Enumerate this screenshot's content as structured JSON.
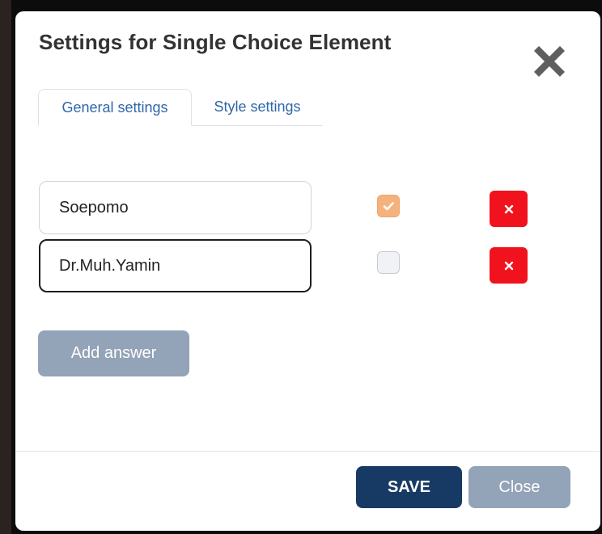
{
  "modal": {
    "title": "Settings for Single Choice Element",
    "close_icon": "close-x-icon"
  },
  "tabs": [
    {
      "label": "General settings",
      "active": true
    },
    {
      "label": "Style settings",
      "active": false
    }
  ],
  "answers": [
    {
      "value": "Soepomo",
      "correct": true,
      "focused": false
    },
    {
      "value": "Dr.Muh.Yamin",
      "correct": false,
      "focused": true
    }
  ],
  "buttons": {
    "add_answer": "Add answer",
    "save": "SAVE",
    "close": "Close",
    "delete_icon": "times-icon"
  },
  "colors": {
    "save": "#173a65",
    "secondary": "#93a3b8",
    "delete": "#f0131d",
    "checked": "#f5b27c",
    "tab_text": "#2f67a8"
  }
}
